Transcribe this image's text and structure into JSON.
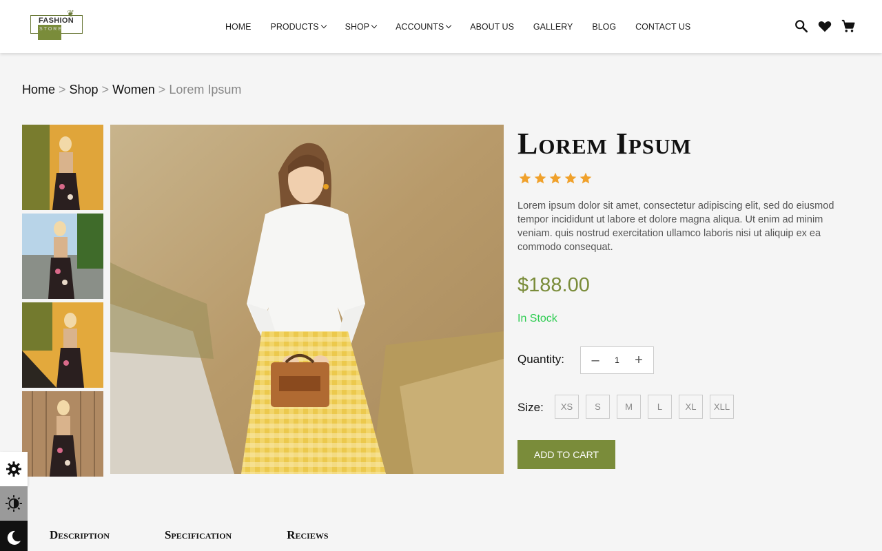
{
  "logo": {
    "line1": "FASHION",
    "line2": "STORE"
  },
  "nav": [
    {
      "label": "HOME",
      "dropdown": false
    },
    {
      "label": "PRODUCTS",
      "dropdown": true
    },
    {
      "label": "SHOP",
      "dropdown": true
    },
    {
      "label": "ACCOUNTS",
      "dropdown": true
    },
    {
      "label": "ABOUT US",
      "dropdown": false
    },
    {
      "label": "GALLERY",
      "dropdown": false
    },
    {
      "label": "BLOG",
      "dropdown": false
    },
    {
      "label": "CONTACT US",
      "dropdown": false
    }
  ],
  "header_icons": [
    "search-icon",
    "heart-icon",
    "cart-icon"
  ],
  "breadcrumb": {
    "home": "Home",
    "shop": "Shop",
    "women": "Women",
    "current": "Lorem Ipsum",
    "separator": ">"
  },
  "product": {
    "title": "Lorem Ipsum",
    "rating": 5,
    "description": "Lorem ipsum dolor sit amet, consectetur adipiscing elit, sed do eiusmod tempor incididunt ut labore et dolore magna aliqua. Ut enim ad minim veniam. quis nostrud exercitation ullamco laboris nisi ut aliquip ex ea commodo consequat.",
    "price": "$188.00",
    "stock": "In Stock",
    "quantity_label": "Quantity:",
    "quantity": "1",
    "minus": "–",
    "plus": "+",
    "size_label": "Size:",
    "sizes": [
      "XS",
      "S",
      "M",
      "L",
      "XL",
      "XLL"
    ],
    "add_to_cart": "ADD TO CART"
  },
  "tabs": [
    {
      "label": "Description"
    },
    {
      "label": "Specification"
    },
    {
      "label": "Reciews"
    }
  ],
  "colors": {
    "accent": "#7a8c3a",
    "stock": "#2ecc52",
    "star": "#f0a12b"
  }
}
